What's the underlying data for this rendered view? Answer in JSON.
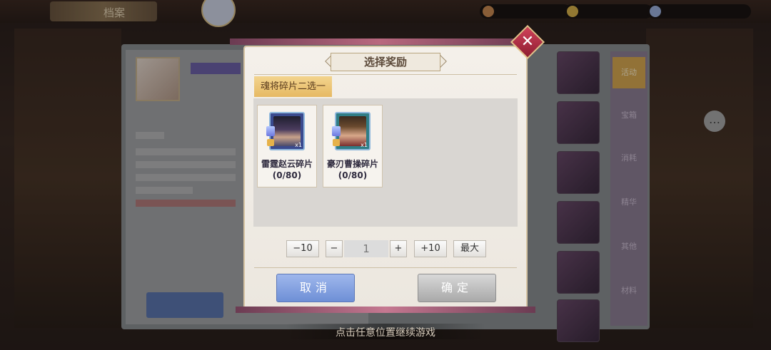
{
  "background": {
    "header_title": "档案",
    "tabs": [
      "活动",
      "宝箱",
      "消耗",
      "精华",
      "其他",
      "材料"
    ]
  },
  "dialog": {
    "title": "选择奖励",
    "section_label": "魂将碎片二选一",
    "rewards": [
      {
        "name": "雷霆赵云碎片",
        "progress": "(0/80)",
        "quantity": "x1"
      },
      {
        "name": "豪刃曹操碎片",
        "progress": "(0/80)",
        "quantity": "x1"
      }
    ],
    "stepper": {
      "minus_ten": "−10",
      "minus": "−",
      "value": "1",
      "plus": "+",
      "plus_ten": "+10",
      "max": "最大"
    },
    "cancel_label": "取消",
    "confirm_label": "确定"
  },
  "footer_hint": "点击任意位置继续游戏",
  "colors": {
    "accent_gold": "#e6b963",
    "cancel_blue": "#7f9fe0",
    "close_red": "#c23a52"
  }
}
